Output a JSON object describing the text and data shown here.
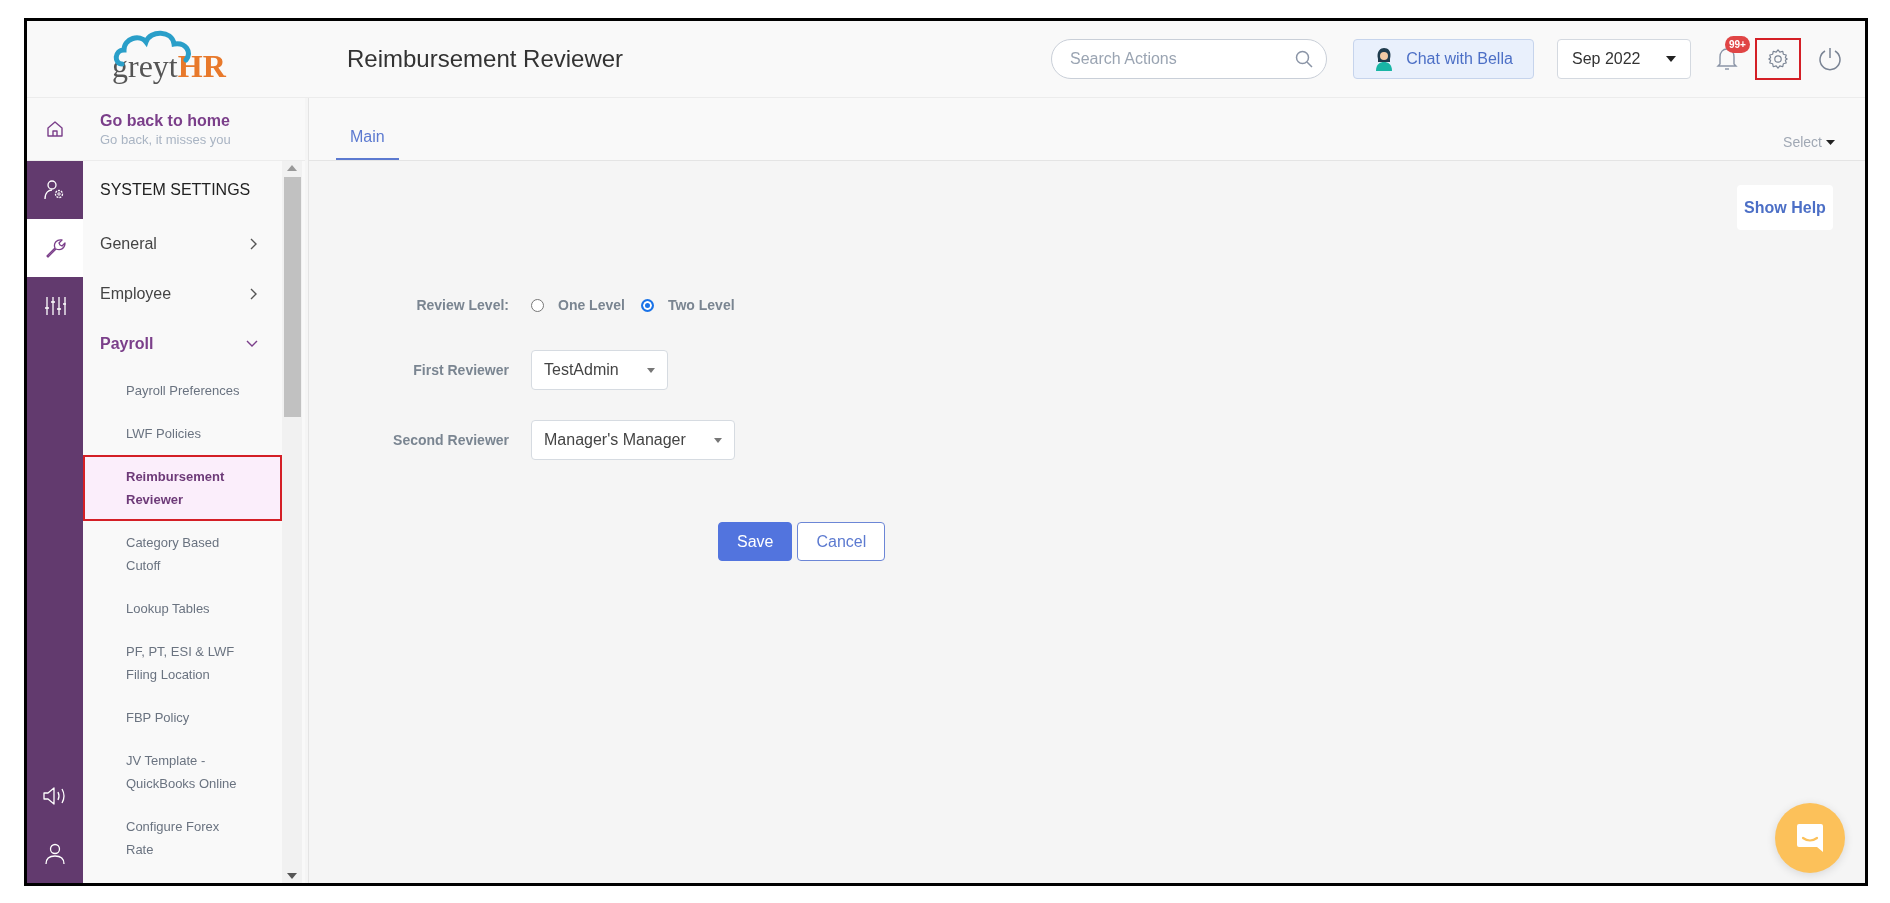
{
  "header": {
    "logo": {
      "text": "greyt",
      "accent": "HR"
    },
    "title": "Reimbursement Reviewer",
    "search": {
      "placeholder": "Search Actions"
    },
    "chat_button": "Chat with Bella",
    "period": "Sep 2022",
    "notification_badge": "99+",
    "settings_highlighted": true
  },
  "home_link": {
    "title": "Go back to home",
    "subtitle": "Go back, it misses you"
  },
  "rail": {
    "top": [
      {
        "kind": "user-settings",
        "selected": false
      },
      {
        "kind": "wrench",
        "selected": true
      },
      {
        "kind": "sliders",
        "selected": false
      }
    ],
    "bottom": [
      {
        "kind": "speaker",
        "selected": false
      },
      {
        "kind": "user",
        "selected": false
      }
    ]
  },
  "sidebar": {
    "heading": "SYSTEM SETTINGS",
    "sections": [
      {
        "label": "General",
        "expanded": false
      },
      {
        "label": "Employee",
        "expanded": false
      },
      {
        "label": "Payroll",
        "expanded": true,
        "children": [
          {
            "label": "Payroll Preferences",
            "selected": false
          },
          {
            "label": "LWF Policies",
            "selected": false
          },
          {
            "label": "Reimbursement Reviewer",
            "selected": true
          },
          {
            "label": "Category Based Cutoff",
            "selected": false
          },
          {
            "label": "Lookup Tables",
            "selected": false
          },
          {
            "label": "PF, PT, ESI & LWF Filing Location",
            "selected": false
          },
          {
            "label": "FBP Policy",
            "selected": false
          },
          {
            "label": "JV Template - QuickBooks Online",
            "selected": false
          },
          {
            "label": "Configure Forex Rate",
            "selected": false
          }
        ]
      }
    ]
  },
  "tabs": [
    {
      "label": "Main",
      "selected": true
    }
  ],
  "view_select": "Select",
  "help_button": "Show Help",
  "form": {
    "review_level": {
      "label": "Review Level:",
      "options": [
        {
          "label": "One Level",
          "selected": false
        },
        {
          "label": "Two Level",
          "selected": true
        }
      ]
    },
    "fields": [
      {
        "label": "First Reviewer",
        "value": "TestAdmin"
      },
      {
        "label": "Second Reviewer",
        "value": "Manager's Manager"
      }
    ],
    "buttons": [
      {
        "label": "Save",
        "kind": "primary"
      },
      {
        "label": "Cancel",
        "kind": "secondary"
      }
    ]
  }
}
